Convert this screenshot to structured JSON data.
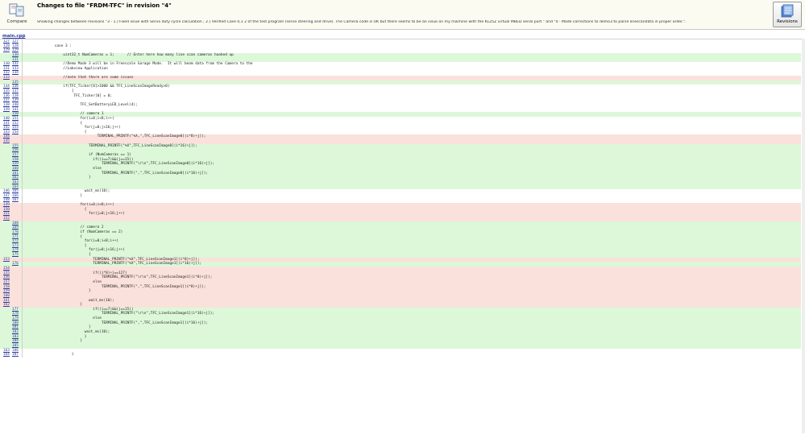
{
  "header": {
    "compare_label": "Compare",
    "title": "Changes to file \"FRDM-TFC\" in revision \"4\"",
    "description": "Showing changes between revisions \"3 - 1.) Fixed issue with Servo duty cycle calculation ; 2.) Verified Case 0,1 2 of the test program (servo steering and drive). The Camera code is OK but there seems to be an issue on my machine with the KL25Z virtual MBED serial port.\" and \"4 - Made corrections to demo3 to parse linescandata in proper order.\".",
    "revisions_label": "Revisions"
  },
  "file_tab": "main.cpp",
  "rows": [
    {
      "t": "ctx",
      "o": "127",
      "n": "127",
      "c": ""
    },
    {
      "t": "ctx",
      "o": "128",
      "n": "128",
      "c": "            case 3 :"
    },
    {
      "t": "ctx",
      "o": "129",
      "n": "129",
      "c": ""
    },
    {
      "t": "add",
      "o": "",
      "n": "130",
      "c": "                uint32_t NumCameras = 1;      // Enter here how many line scan cameras hooked up"
    },
    {
      "t": "add",
      "o": "",
      "n": "131",
      "c": ""
    },
    {
      "t": "ctx",
      "o": "130",
      "n": "132",
      "c": "                //Demo Mode 3 will be in Freescale Garage Mode.  It will beam data from the Camera to the"
    },
    {
      "t": "ctx",
      "o": "131",
      "n": "133",
      "c": "                //Labview Application"
    },
    {
      "t": "ctx",
      "o": "132",
      "n": "134",
      "c": ""
    },
    {
      "t": "del",
      "o": "133",
      "n": "",
      "c": "                //note that there are some issues"
    },
    {
      "t": "add",
      "o": "",
      "n": "135",
      "c": ""
    },
    {
      "t": "ctx",
      "o": "134",
      "n": "136",
      "c": "                if(TFC_Ticker[0]>1000 && TFC_LineScanImageReady>0)"
    },
    {
      "t": "ctx",
      "o": "135",
      "n": "137",
      "c": "                    {"
    },
    {
      "t": "ctx",
      "o": "136",
      "n": "138",
      "c": "                     TFC_Ticker[0] = 0;"
    },
    {
      "t": "ctx",
      "o": "137",
      "n": "139",
      "c": ""
    },
    {
      "t": "ctx",
      "o": "138",
      "n": "140",
      "c": "                        TFC_SetBatteryLED_Level(4);"
    },
    {
      "t": "ctx",
      "o": "139",
      "n": "141",
      "c": ""
    },
    {
      "t": "add",
      "o": "",
      "n": "150",
      "c": "                        // camera 1"
    },
    {
      "t": "ctx",
      "o": "140",
      "n": "151",
      "c": "                        for(i=0;i<8;i++)"
    },
    {
      "t": "ctx",
      "o": "141",
      "n": "152",
      "c": "                        {"
    },
    {
      "t": "ctx",
      "o": "142",
      "n": "153",
      "c": "                          for(j=0;j<16;j++)"
    },
    {
      "t": "ctx",
      "o": "143",
      "n": "154",
      "c": "                          {"
    },
    {
      "t": "del",
      "o": "144",
      "n": "",
      "c": "                                TERMINAL_PRINTF(\"%X,\",TFC_LineScanImage0[(i*8)+j]);"
    },
    {
      "t": "del",
      "o": "145",
      "n": "",
      "c": ""
    },
    {
      "t": "add",
      "o": "",
      "n": "155",
      "c": "                            TERMINAL_PRINTF(\"%X\",TFC_LineScanImage0[(i*16)+j]);"
    },
    {
      "t": "add",
      "o": "",
      "n": "156",
      "c": ""
    },
    {
      "t": "add",
      "o": "",
      "n": "157",
      "c": "                            if (NumCameras == 1)"
    },
    {
      "t": "add",
      "o": "",
      "n": "158",
      "c": "                              if((i==7)&&(j==15))"
    },
    {
      "t": "add",
      "o": "",
      "n": "159",
      "c": "                                  TERMINAL_PRINTF(\"\\r\\n\",TFC_LineScanImage0[(i*16)+j]);"
    },
    {
      "t": "add",
      "o": "",
      "n": "160",
      "c": "                              else"
    },
    {
      "t": "add",
      "o": "",
      "n": "161",
      "c": "                                  TERMINAL_PRINTF(\",\",TFC_LineScanImage0[(i*16)+j]);"
    },
    {
      "t": "add",
      "o": "",
      "n": "162",
      "c": "                            }"
    },
    {
      "t": "add",
      "o": "",
      "n": "163",
      "c": ""
    },
    {
      "t": "add",
      "o": "",
      "n": "164",
      "c": ""
    },
    {
      "t": "ctx",
      "o": "146",
      "n": "165",
      "c": "                          wait_ms(10);"
    },
    {
      "t": "ctx",
      "o": "147",
      "n": "166",
      "c": "                        }"
    },
    {
      "t": "ctx",
      "o": "148",
      "n": "167",
      "c": ""
    },
    {
      "t": "del",
      "o": "149",
      "n": "",
      "c": "                        for(i=0;i<8;i++)"
    },
    {
      "t": "del",
      "o": "150",
      "n": "",
      "c": "                          {"
    },
    {
      "t": "del",
      "o": "151",
      "n": "",
      "c": "                            for(j=0;j<16;j++)"
    },
    {
      "t": "del",
      "o": "152",
      "n": "",
      "c": ""
    },
    {
      "t": "add",
      "o": "",
      "n": "168",
      "c": ""
    },
    {
      "t": "add",
      "o": "",
      "n": "169",
      "c": "                        // camera 2"
    },
    {
      "t": "add",
      "o": "",
      "n": "170",
      "c": "                        if (NumCameras == 2)"
    },
    {
      "t": "add",
      "o": "",
      "n": "171",
      "c": "                        {"
    },
    {
      "t": "add",
      "o": "",
      "n": "172",
      "c": "                          for(i=0;i<8;i++)"
    },
    {
      "t": "add",
      "o": "",
      "n": "173",
      "c": "                          {"
    },
    {
      "t": "add",
      "o": "",
      "n": "174",
      "c": "                            for(j=0;j<16;j++)"
    },
    {
      "t": "add",
      "o": "",
      "n": "175",
      "c": "                            {"
    },
    {
      "t": "del",
      "o": "153",
      "n": "",
      "c": "                              TERMINAL_PRINTF(\"%X\",TFC_LineScanImage1[(i*8)+j]);"
    },
    {
      "t": "add",
      "o": "",
      "n": "176",
      "c": "                              TERMINAL_PRINTF(\"%X\",TFC_LineScanImage1[(i*16)+j]);"
    },
    {
      "t": "del",
      "o": "154",
      "n": "",
      "c": ""
    },
    {
      "t": "del",
      "o": "155",
      "n": "",
      "c": "                              if((i*8)+j==127)"
    },
    {
      "t": "del",
      "o": "156",
      "n": "",
      "c": "                                  TERMINAL_PRINTF(\"\\r\\n\",TFC_LineScanImage1[(i*8)+j]);"
    },
    {
      "t": "del",
      "o": "157",
      "n": "",
      "c": "                              else"
    },
    {
      "t": "del",
      "o": "158",
      "n": "",
      "c": "                                  TERMINAL_PRINTF(\",\",TFC_LineScanImage1[(i*8)+j]);"
    },
    {
      "t": "del",
      "o": "159",
      "n": "",
      "c": "                            }"
    },
    {
      "t": "del",
      "o": "160",
      "n": "",
      "c": ""
    },
    {
      "t": "del",
      "o": "161",
      "n": "",
      "c": "                            wait_ms(10);"
    },
    {
      "t": "del",
      "o": "162",
      "n": "",
      "c": "                        }"
    },
    {
      "t": "add",
      "o": "",
      "n": "177",
      "c": "                              if((i==7)&&(j==15))"
    },
    {
      "t": "add",
      "o": "",
      "n": "178",
      "c": "                                  TERMINAL_PRINTF(\"\\r\\n\",TFC_LineScanImage1[(i*16)+j]);"
    },
    {
      "t": "add",
      "o": "",
      "n": "179",
      "c": "                              else"
    },
    {
      "t": "add",
      "o": "",
      "n": "180",
      "c": "                                  TERMINAL_PRINTF(\",\",TFC_LineScanImage1[(i*16)+j]);"
    },
    {
      "t": "add",
      "o": "",
      "n": "181",
      "c": "                            }"
    },
    {
      "t": "add",
      "o": "",
      "n": "182",
      "c": "                          wait_ms(10);"
    },
    {
      "t": "add",
      "o": "",
      "n": "183",
      "c": "                          }"
    },
    {
      "t": "add",
      "o": "",
      "n": "184",
      "c": "                        }"
    },
    {
      "t": "add",
      "o": "",
      "n": "185",
      "c": ""
    },
    {
      "t": "ctx",
      "o": "163",
      "n": "186",
      "c": ""
    },
    {
      "t": "ctx",
      "o": "164",
      "n": "187",
      "c": "                    }"
    }
  ]
}
